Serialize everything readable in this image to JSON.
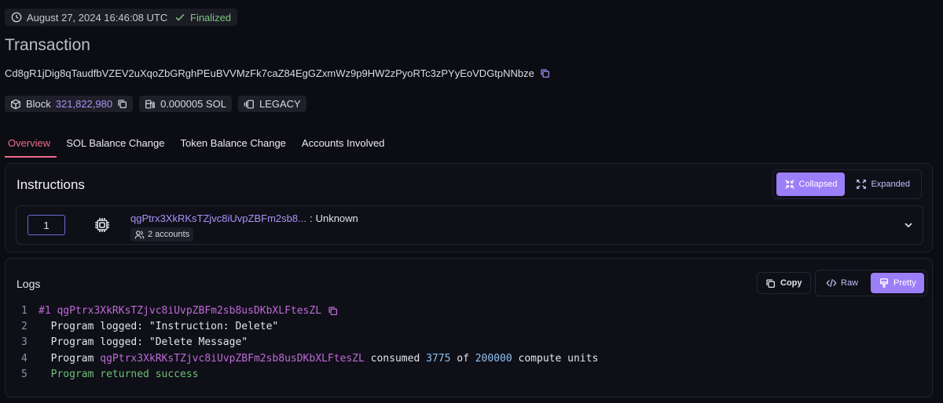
{
  "header": {
    "timestamp": "August 27, 2024 16:46:08 UTC",
    "status": "Finalized",
    "title": "Transaction",
    "signature": "Cd8gR1jDig8qTaudfbVZEV2uXqoZbGRghPEuBVVMzFk7caZ84EgGZxmWz9p9HW2zPyoRTc3zPYyEoVDGtpNNbze"
  },
  "meta": {
    "block_label": "Block",
    "block_number": "321,822,980",
    "fee": "0.000005 SOL",
    "version": "LEGACY"
  },
  "tabs": [
    {
      "label": "Overview",
      "active": true
    },
    {
      "label": "SOL Balance Change",
      "active": false
    },
    {
      "label": "Token Balance Change",
      "active": false
    },
    {
      "label": "Accounts Involved",
      "active": false
    }
  ],
  "instructions": {
    "title": "Instructions",
    "view_toggle": {
      "collapsed": "Collapsed",
      "expanded": "Expanded",
      "selected": "Collapsed"
    },
    "items": [
      {
        "index": "1",
        "program": "qgPtrx3XkRKsTZjvc8iUvpZBFm2sb8...",
        "separator": ":",
        "type": "Unknown",
        "accounts": "2 accounts"
      }
    ]
  },
  "logs": {
    "title": "Logs",
    "copy_label": "Copy",
    "format_toggle": {
      "raw": "Raw",
      "pretty": "Pretty",
      "selected": "Pretty"
    },
    "lines": [
      {
        "no": "1",
        "prefix": "#1 ",
        "program": "qgPtrx3XkRKsTZjvc8iUvpZBFm2sb8usDKbXLFtesZL"
      },
      {
        "no": "2",
        "text": "  Program logged: \"Instruction: Delete\""
      },
      {
        "no": "3",
        "text": "  Program logged: \"Delete Message\""
      },
      {
        "no": "4",
        "pre": "  Program ",
        "program": "qgPtrx3XkRKsTZjvc8iUvpZBFm2sb8usDKbXLFtesZL",
        "mid1": " consumed ",
        "consumed": "3775",
        "mid2": " of ",
        "limit": "200000",
        "tail": " compute units"
      },
      {
        "no": "5",
        "success": "  Program returned success"
      }
    ]
  },
  "colors": {
    "accent": "#9c7ef8",
    "link": "#a893f6",
    "active_tab": "#ee6d8a",
    "success": "#6fbf73"
  }
}
